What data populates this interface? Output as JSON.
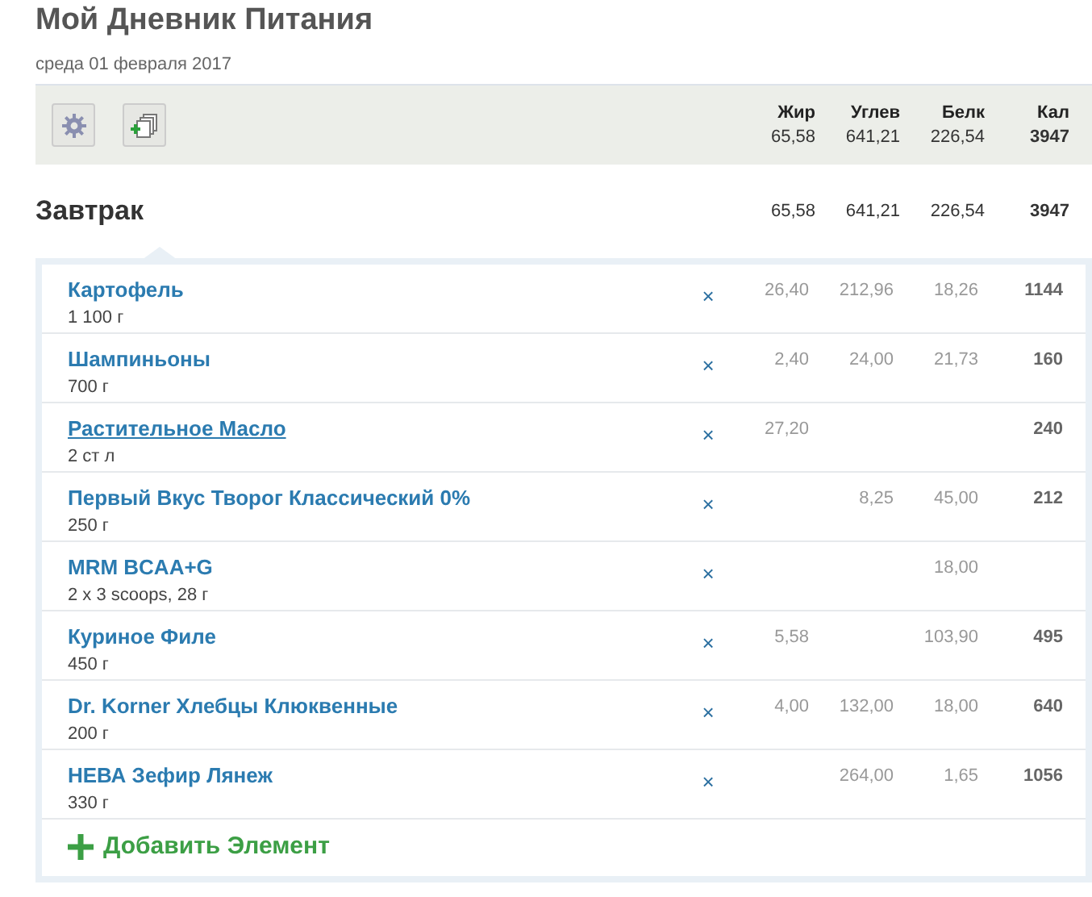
{
  "title": "Мой Дневник Питания",
  "date": "среда 01 февраля 2017",
  "totals": {
    "columns": [
      {
        "label": "Жир",
        "value": "65,58"
      },
      {
        "label": "Углев",
        "value": "641,21"
      },
      {
        "label": "Белк",
        "value": "226,54"
      },
      {
        "label": "Кал",
        "value": "3947"
      }
    ]
  },
  "meal": {
    "name": "Завтрак",
    "values": [
      "65,58",
      "641,21",
      "226,54",
      "3947"
    ],
    "items": [
      {
        "name": "Картофель",
        "amount": "1 100 г",
        "remove": "×",
        "hovered": false,
        "values": {
          "fat": "26,40",
          "carbs": "212,96",
          "protein": "18,26",
          "kcal": "1144"
        }
      },
      {
        "name": "Шампиньоны",
        "amount": "700 г",
        "remove": "×",
        "hovered": false,
        "values": {
          "fat": "2,40",
          "carbs": "24,00",
          "protein": "21,73",
          "kcal": "160"
        }
      },
      {
        "name": "Растительное Масло",
        "amount": "2 ст л",
        "remove": "×",
        "hovered": true,
        "values": {
          "fat": "27,20",
          "kcal": "240"
        }
      },
      {
        "name": "Первый Вкус Творог Классический 0%",
        "amount": "250 г",
        "remove": "×",
        "hovered": false,
        "values": {
          "carbs": "8,25",
          "protein": "45,00",
          "kcal": "212"
        }
      },
      {
        "name": "MRM BCAA+G",
        "amount": "2 x 3 scoops, 28 г",
        "remove": "×",
        "hovered": false,
        "values": {
          "protein": "18,00"
        }
      },
      {
        "name": "Куриное Филе",
        "amount": "450 г",
        "remove": "×",
        "hovered": false,
        "values": {
          "fat": "5,58",
          "protein": "103,90",
          "kcal": "495"
        }
      },
      {
        "name": "Dr. Korner Хлебцы Клюквенные",
        "amount": "200 г",
        "remove": "×",
        "hovered": false,
        "values": {
          "fat": "4,00",
          "carbs": "132,00",
          "protein": "18,00",
          "kcal": "640"
        }
      },
      {
        "name": "НЕВА Зефир Лянеж",
        "amount": "330 г",
        "remove": "×",
        "hovered": false,
        "values": {
          "carbs": "264,00",
          "protein": "1,65",
          "kcal": "1056"
        }
      }
    ],
    "add_label": "Добавить Элемент"
  }
}
